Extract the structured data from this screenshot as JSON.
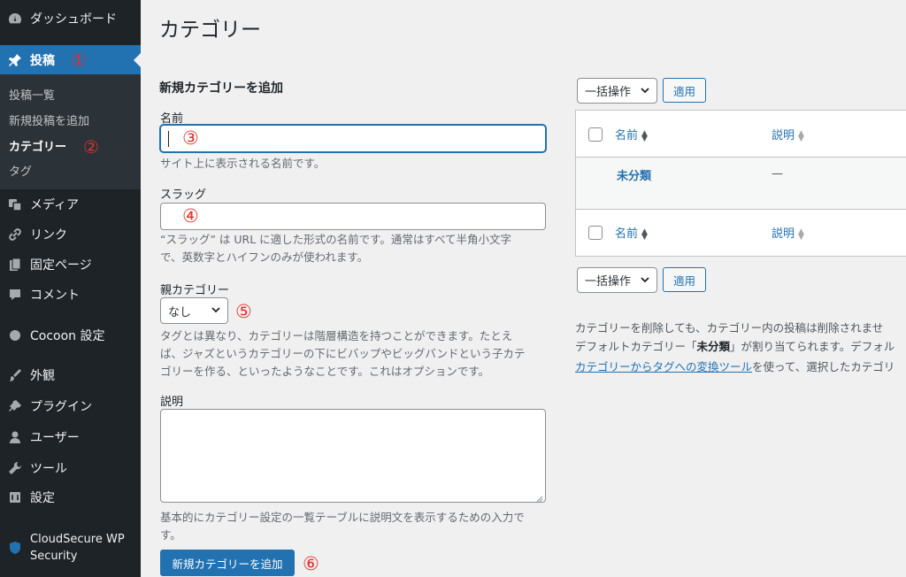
{
  "sidebar": {
    "items": [
      {
        "label": "ダッシュボード",
        "icon": "dashboard-icon"
      },
      {
        "label": "投稿",
        "icon": "pin-icon",
        "marker": "①"
      },
      {
        "label": "メディア",
        "icon": "media-icon"
      },
      {
        "label": "リンク",
        "icon": "link-icon"
      },
      {
        "label": "固定ページ",
        "icon": "page-icon"
      },
      {
        "label": "コメント",
        "icon": "comment-icon"
      },
      {
        "label": "Cocoon 設定",
        "icon": "cocoon-icon"
      },
      {
        "label": "外観",
        "icon": "appearance-icon"
      },
      {
        "label": "プラグイン",
        "icon": "plugin-icon"
      },
      {
        "label": "ユーザー",
        "icon": "user-icon"
      },
      {
        "label": "ツール",
        "icon": "tools-icon"
      },
      {
        "label": "設定",
        "icon": "settings-icon"
      },
      {
        "label": "CloudSecure WP Security",
        "icon": "shield-icon"
      }
    ],
    "submenu": [
      {
        "label": "投稿一覧"
      },
      {
        "label": "新規投稿を追加"
      },
      {
        "label": "カテゴリー",
        "marker": "②"
      },
      {
        "label": "タグ"
      }
    ]
  },
  "page": {
    "title": "カテゴリー"
  },
  "form": {
    "heading": "新規カテゴリーを追加",
    "name_label": "名前",
    "name_marker": "③",
    "name_value": "",
    "name_desc": "サイト上に表示される名前です。",
    "slug_label": "スラッグ",
    "slug_marker": "④",
    "slug_value": "",
    "slug_desc_line1": "“スラッグ” は URL に適した形式の名前です。通常はすべて半角小文字",
    "slug_desc_line2": "で、英数字とハイフンのみが使われます。",
    "parent_label": "親カテゴリー",
    "parent_selected": "なし",
    "parent_marker": "⑤",
    "parent_desc_line1": "タグとは異なり、カテゴリーは階層構造を持つことができます。たとえ",
    "parent_desc_line2": "ば、ジャズというカテゴリーの下にビバップやビッグバンドという子カテ",
    "parent_desc_line3": "ゴリーを作る、といったようなことです。これはオプションです。",
    "description_label": "説明",
    "description_value": "",
    "description_desc_line1": "基本的にカテゴリー設定の一覧テーブルに説明文を表示するための入力で",
    "description_desc_line2": "す。",
    "submit_label": "新規カテゴリーを追加",
    "submit_marker": "⑥"
  },
  "table": {
    "bulk_action": "一括操作",
    "apply": "適用",
    "col_name": "名前",
    "col_desc": "説明",
    "rows": [
      {
        "name": "未分類",
        "desc": "—"
      }
    ]
  },
  "notes": {
    "line1": "カテゴリーを削除しても、カテゴリー内の投稿は削除されませ",
    "line2_pre": "デフォルトカテゴリー「",
    "line2_bold": "未分類",
    "line2_post": "」が割り当てられます。デフォル",
    "line3_link": "カテゴリーからタグへの変換ツール",
    "line3_post": "を使って、選択したカテゴリ"
  },
  "colors": {
    "accent": "#2271b1",
    "sidebar_bg": "#1d2327",
    "marker_red": "#e0312a"
  }
}
